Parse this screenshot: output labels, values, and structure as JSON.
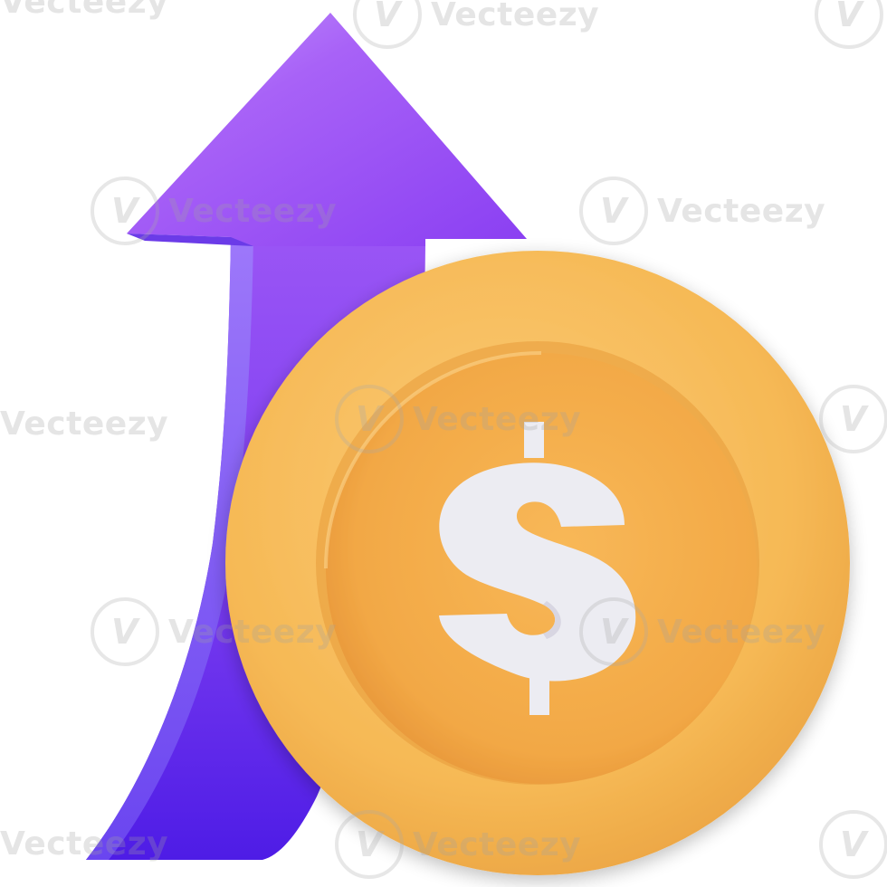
{
  "image": {
    "subject": "growth-arrow-and-dollar-coin",
    "coin_symbol": "$",
    "colors": {
      "arrow_light": "#B27BFA",
      "arrow_mid": "#8E45F3",
      "arrow_dark": "#4E1CE6",
      "coin_face": "#F5B24F",
      "coin_rim": "#F7BD5E",
      "coin_shadow": "#E39A34",
      "symbol": "#ECECF2"
    },
    "icons": [
      "up-arrow-icon",
      "dollar-coin-icon"
    ]
  },
  "watermarks": [
    {
      "text": "Vecteezy",
      "logo": "V"
    },
    {
      "text": "Vecteezy",
      "logo": "V"
    },
    {
      "text": "Vecteezy",
      "logo": "V"
    },
    {
      "text": "Vecteezy",
      "logo": "V"
    },
    {
      "text": "Vecteezy",
      "logo": "V"
    },
    {
      "text": "Vecteezy",
      "logo": "V"
    },
    {
      "text": "Vecteezy",
      "logo": "V"
    },
    {
      "text": "Vecteezy",
      "logo": "V"
    },
    {
      "text": "Vecteezy",
      "logo": "V"
    },
    {
      "text": "Vecteezy",
      "logo": "V"
    },
    {
      "text": "Vecteezy",
      "logo": "V"
    },
    {
      "text": "Vecteezy",
      "logo": "V"
    },
    {
      "text": "Vecteezy",
      "logo": "V"
    }
  ]
}
